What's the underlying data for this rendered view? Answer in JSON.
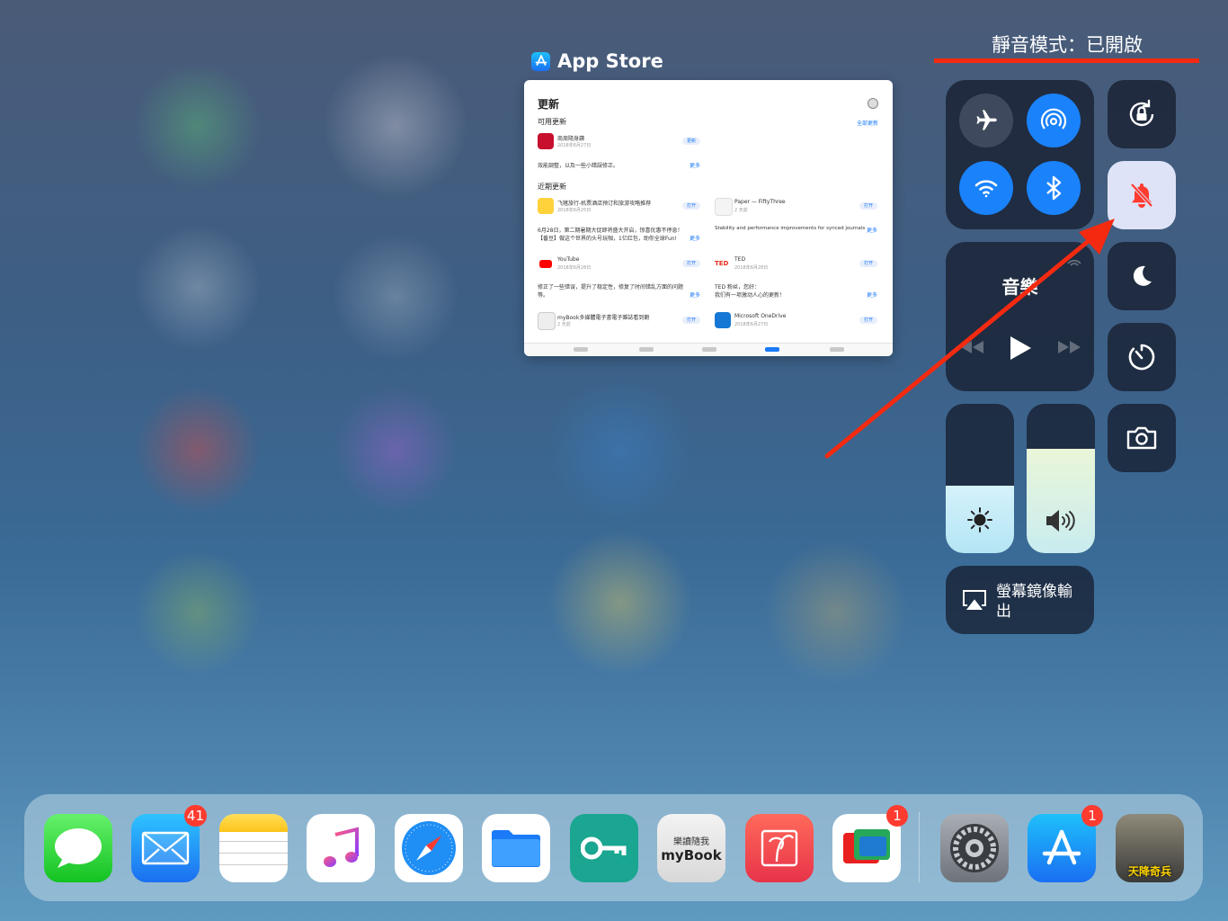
{
  "background": {
    "base_color": "#3d5f85"
  },
  "app_switcher": {
    "app_name": "App Store",
    "card": {
      "header": "更新",
      "available_section": "可用更新",
      "update_all_link": "全部更新",
      "available_items": [
        {
          "name": "商周隨身讀",
          "date": "2018年6月27日",
          "button": "更新"
        }
      ],
      "available_note": "效能調整，以及一些小錯誤修正。",
      "more_label": "更多",
      "recent_section": "近期更新",
      "recent_items": [
        {
          "name": "飞猪旅行-机票酒店预订和旅游攻略推荐",
          "date": "2018年6月25日",
          "button": "打开",
          "note": "6月28日，第二期暑期大促即将盛大开启，惊喜优惠不停息！",
          "note2": "【番豆】做这个世界的头号玩咖，1亿红包，助你全球Fun!"
        },
        {
          "name": "Paper — FiftyThree",
          "date": "2 天前",
          "button": "打开",
          "note": "Stability and performance improvements for synced journals"
        },
        {
          "name": "YouTube",
          "date": "2018年6月28日",
          "button": "打开",
          "note": "修正了一些错误，提升了稳定性，修复了时间错乱方面的问题",
          "note2": "等。"
        },
        {
          "name": "TED",
          "date": "2018年6月28日",
          "button": "打开",
          "note": "TED 粉丝，您好：",
          "note2": "我们有一项激动人心的更新！"
        },
        {
          "name": "myBook多媒體電子書電子雜誌看到飽",
          "date": "2 天前",
          "button": "打开"
        },
        {
          "name": "Microsoft OneDrive",
          "date": "2018年6月27日",
          "button": "打开"
        }
      ]
    }
  },
  "annotation": {
    "label": "靜音模式：已開啟",
    "color": "#f42a10"
  },
  "control_center": {
    "airplane_mode": false,
    "airdrop": true,
    "wifi": true,
    "bluetooth": true,
    "rotation_lock": false,
    "silent_mode": true,
    "do_not_disturb": false,
    "music": {
      "title": "音樂"
    },
    "brightness_level": 0.45,
    "volume_level": 0.7,
    "screen_mirroring": "螢幕鏡像輸出",
    "active_color": "#1a82fb"
  },
  "dock": {
    "apps": [
      {
        "name": "Messages",
        "badge": ""
      },
      {
        "name": "Mail",
        "badge": "41"
      },
      {
        "name": "Notes",
        "badge": ""
      },
      {
        "name": "Music",
        "badge": ""
      },
      {
        "name": "Safari",
        "badge": ""
      },
      {
        "name": "Files",
        "badge": ""
      },
      {
        "name": "VPN",
        "badge": ""
      },
      {
        "name": "myBook",
        "label": "myBook",
        "label_top": "樂讀隨我",
        "badge": ""
      },
      {
        "name": "Pixelmator",
        "badge": ""
      },
      {
        "name": "Wallet",
        "badge": "1"
      },
      {
        "name": "Settings",
        "badge": ""
      },
      {
        "name": "App Store",
        "badge": "1"
      },
      {
        "name": "PUBG Mobile",
        "label": "天降奇兵",
        "badge": ""
      }
    ]
  }
}
